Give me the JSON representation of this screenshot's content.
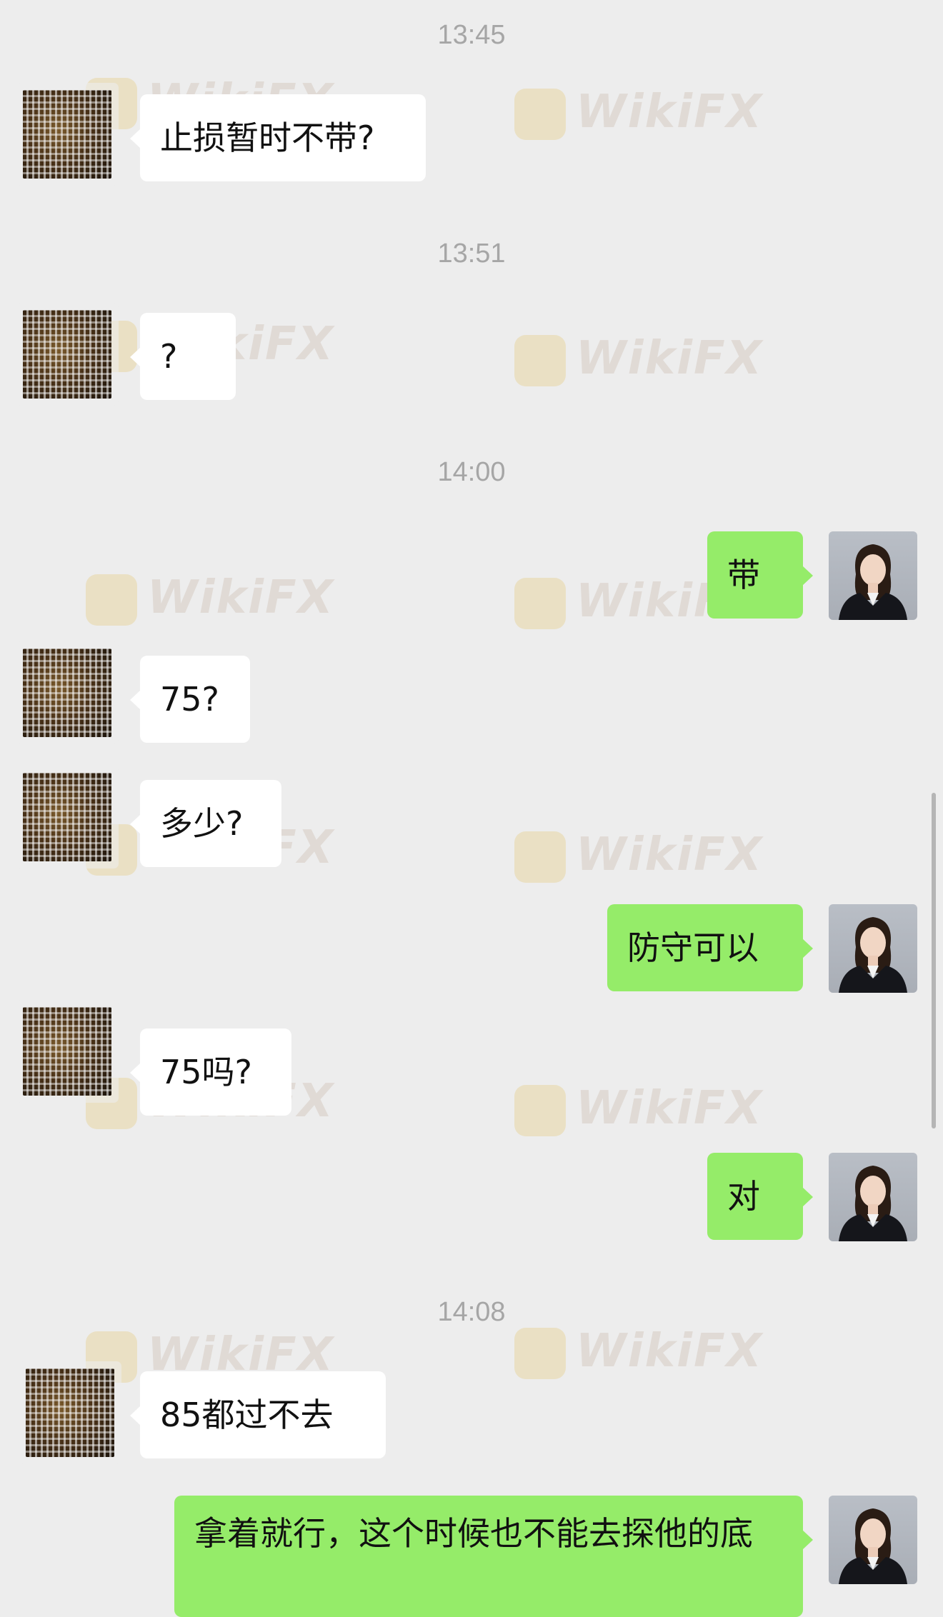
{
  "watermark": "WikiFX",
  "timestamps": [
    "13:45",
    "13:51",
    "14:00",
    "14:08"
  ],
  "messages": {
    "m1": "止损暂时不带?",
    "m2": "?",
    "m3": "带",
    "m4": "75?",
    "m5": "多少?",
    "m6": "防守可以",
    "m7": "75吗?",
    "m8": "对",
    "m9": "85都过不去",
    "m10": "拿着就行，这个时候也不能去探他的底"
  },
  "colors": {
    "background": "#ededed",
    "incoming_bubble": "#ffffff",
    "outgoing_bubble": "#95ec69",
    "timestamp": "#a6a6a6"
  },
  "icons": {
    "other_avatar": "pixelated-avatar",
    "self_avatar": "woman-in-suit-avatar"
  }
}
